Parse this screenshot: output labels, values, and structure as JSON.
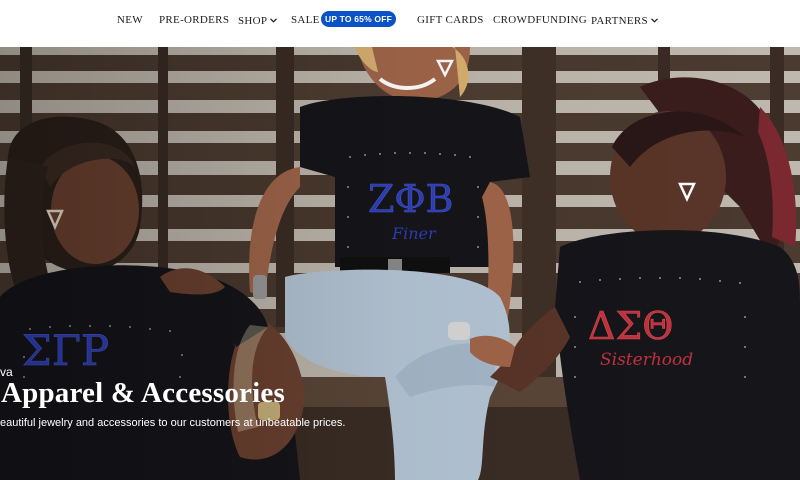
{
  "nav": {
    "items": [
      {
        "label": "NEW",
        "has_dropdown": false
      },
      {
        "label": "PRE-ORDERS",
        "has_dropdown": false
      },
      {
        "label": "SHOP",
        "has_dropdown": true
      },
      {
        "label": "SALE",
        "has_dropdown": false
      },
      {
        "label": "GIFT CARDS",
        "has_dropdown": false
      },
      {
        "label": "CROWDFUNDING",
        "has_dropdown": false
      },
      {
        "label": "PARTNERS",
        "has_dropdown": true
      }
    ],
    "sale_badge": "UP TO 65% OFF",
    "badge_color": "#0a52c6"
  },
  "hero": {
    "eyebrow": "va",
    "title": "Apparel & Accessories",
    "subtitle": "eautiful jewelry and accessories to our customers at unbeatable prices.",
    "shirt_letters": [
      "ΣΓΡ",
      "ΖΦΒ",
      "ΔΣΘ"
    ],
    "shirt_scripts": [
      "Sisterhood",
      "Finer",
      "Sisterhood"
    ],
    "colors": {
      "royal_blue": "#2f3fb6",
      "crimson": "#c2333e",
      "shirt_black": "#15151a"
    }
  }
}
